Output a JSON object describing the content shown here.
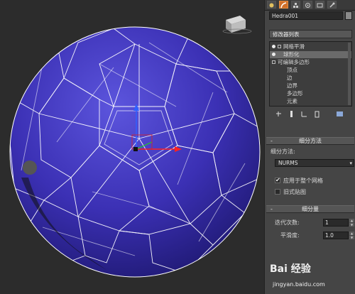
{
  "object": {
    "name": "Hedra001"
  },
  "modifier_list": {
    "label": "修改器列表"
  },
  "stack": {
    "items": [
      {
        "label": "网格平滑"
      },
      {
        "label": "球形化"
      },
      {
        "label": "可编辑多边形"
      },
      {
        "label": "顶点"
      },
      {
        "label": "边"
      },
      {
        "label": "边界"
      },
      {
        "label": "多边形"
      },
      {
        "label": "元素"
      }
    ]
  },
  "subdivision_method": {
    "title": "细分方法",
    "method_label": "细分方法:",
    "method_value": "NURMS",
    "apply_whole_mesh_label": "应用于整个网格",
    "apply_whole_mesh_checked": true,
    "old_style_mapping_label": "旧式贴图",
    "old_style_mapping_checked": false
  },
  "subdivision_amount": {
    "title": "细分量",
    "iterations_label": "迭代次数:",
    "iterations_value": "1",
    "smoothness_label": "平滑度:",
    "smoothness_value": "1.0"
  },
  "watermark": {
    "brand": "Bai 经验",
    "url": "jingyan.baidu.com"
  },
  "icons": {
    "tabs": [
      "create-icon",
      "modify-icon",
      "hierarchy-icon",
      "motion-icon",
      "display-icon",
      "utilities-icon"
    ],
    "stack_tools": [
      "pin-stack-icon",
      "show-end-result-icon",
      "make-unique-icon",
      "remove-modifier-icon",
      "configure-modifier-sets-icon"
    ]
  },
  "colors": {
    "sphere": "#3d33b8",
    "wire": "#ffffff",
    "active_tab": "#d0702a"
  }
}
